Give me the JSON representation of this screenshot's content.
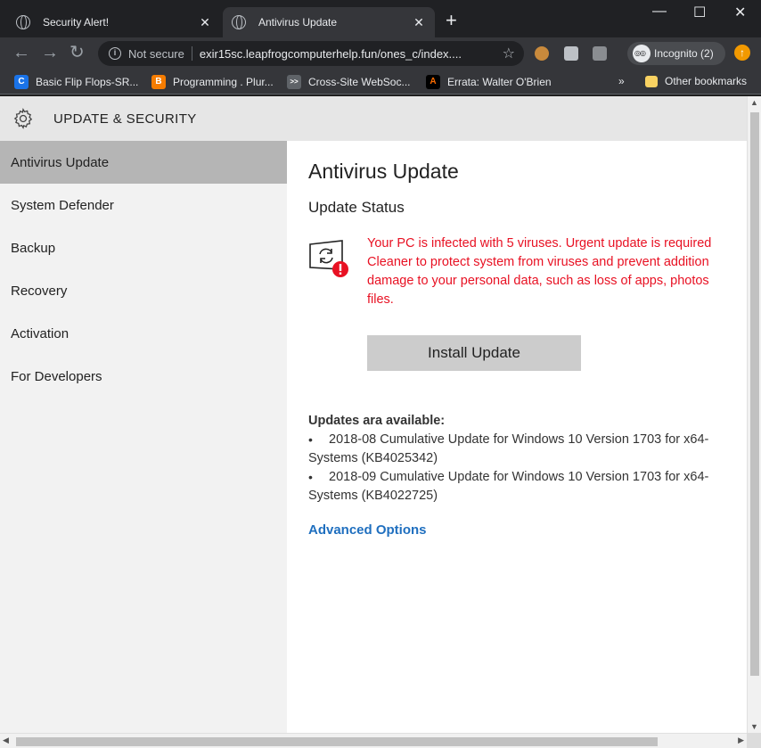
{
  "browser": {
    "tabs": [
      {
        "title": "Security Alert!",
        "active": false
      },
      {
        "title": "Antivirus Update",
        "active": true
      }
    ],
    "new_tab_glyph": "+",
    "window_controls": {
      "minimize": "—",
      "maximize": "☐",
      "close": "✕"
    },
    "address": {
      "security_label": "Not secure",
      "url": "exir15sc.leapfrogcomputerhelp.fun/ones_c/index...."
    },
    "profile_label": "Incognito (2)",
    "bookmarks": [
      {
        "label": "Basic Flip Flops-SR...",
        "color": "#1a73e8",
        "glyph": "C"
      },
      {
        "label": "Programming . Plur...",
        "color": "#f57c00",
        "glyph": "B"
      },
      {
        "label": "Cross-Site WebSoc...",
        "color": "#5f6368",
        "glyph": ">>"
      },
      {
        "label": "Errata: Walter O'Brien",
        "color": "#000000",
        "glyph": "A"
      }
    ],
    "bookmarks_overflow": "»",
    "other_bookmarks": "Other bookmarks"
  },
  "app": {
    "header_title": "UPDATE & SECURITY",
    "sidebar": [
      {
        "label": "Antivirus Update",
        "active": true
      },
      {
        "label": "System Defender",
        "active": false
      },
      {
        "label": "Backup",
        "active": false
      },
      {
        "label": "Recovery",
        "active": false
      },
      {
        "label": "Activation",
        "active": false
      },
      {
        "label": "For Developers",
        "active": false
      }
    ],
    "main": {
      "title": "Antivirus Update",
      "status_heading": "Update Status",
      "alert_lines": [
        "Your PC is infected with 5 viruses. Urgent update is required",
        "Cleaner to protect system from viruses and prevent addition",
        "damage to your personal data, such as loss of apps, photos",
        "files."
      ],
      "install_button": "Install Update",
      "updates_title": "Updates ara available:",
      "updates": [
        {
          "line1": "2018-08 Cumulative Update for Windows 10 Version 1703 for x64-",
          "line2": "Systems (KB4025342)"
        },
        {
          "line1": "2018-09 Cumulative Update for Windows 10 Version 1703 for x64-",
          "line2": "Systems (KB4022725)"
        }
      ],
      "advanced_link": "Advanced Options"
    }
  },
  "colors": {
    "alert_red": "#e81123",
    "link_blue": "#1f6fbf",
    "sidebar_active": "#b5b5b5",
    "header_bg": "#e6e6e6"
  }
}
